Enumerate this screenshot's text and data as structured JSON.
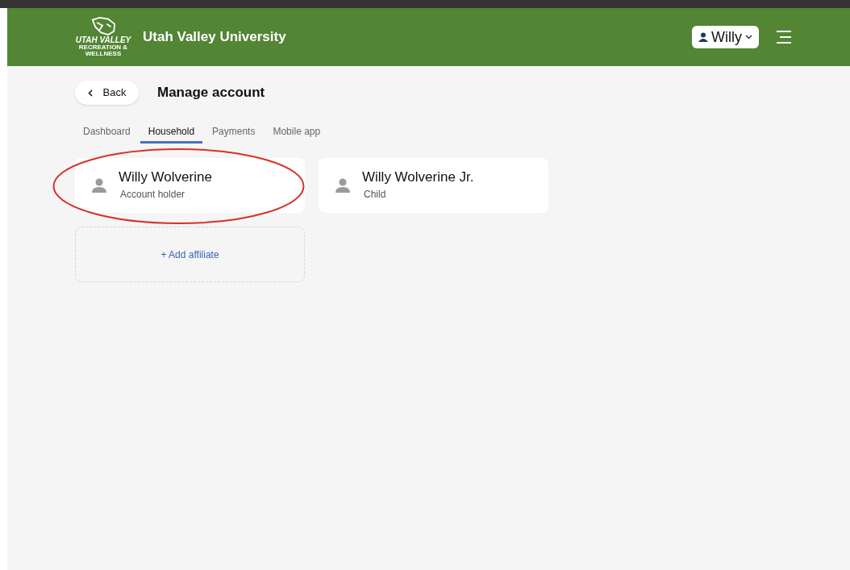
{
  "header": {
    "logo_lines": [
      "UTAH VALLEY",
      "RECREATION &",
      "WELLNESS"
    ],
    "title": "Utah Valley University",
    "user_menu": {
      "label": "Willy"
    }
  },
  "page": {
    "back": "Back",
    "title": "Manage account"
  },
  "tabs": [
    {
      "label": "Dashboard",
      "selected": false
    },
    {
      "label": "Household",
      "selected": true
    },
    {
      "label": "Payments",
      "selected": false
    },
    {
      "label": "Mobile app",
      "selected": false
    }
  ],
  "members": [
    {
      "name": "Willy Wolverine",
      "role": "Account holder",
      "circled": true
    },
    {
      "name": "Willy Wolverine Jr.",
      "role": "Child",
      "circled": false
    }
  ],
  "add_affiliate": "+ Add affiliate"
}
